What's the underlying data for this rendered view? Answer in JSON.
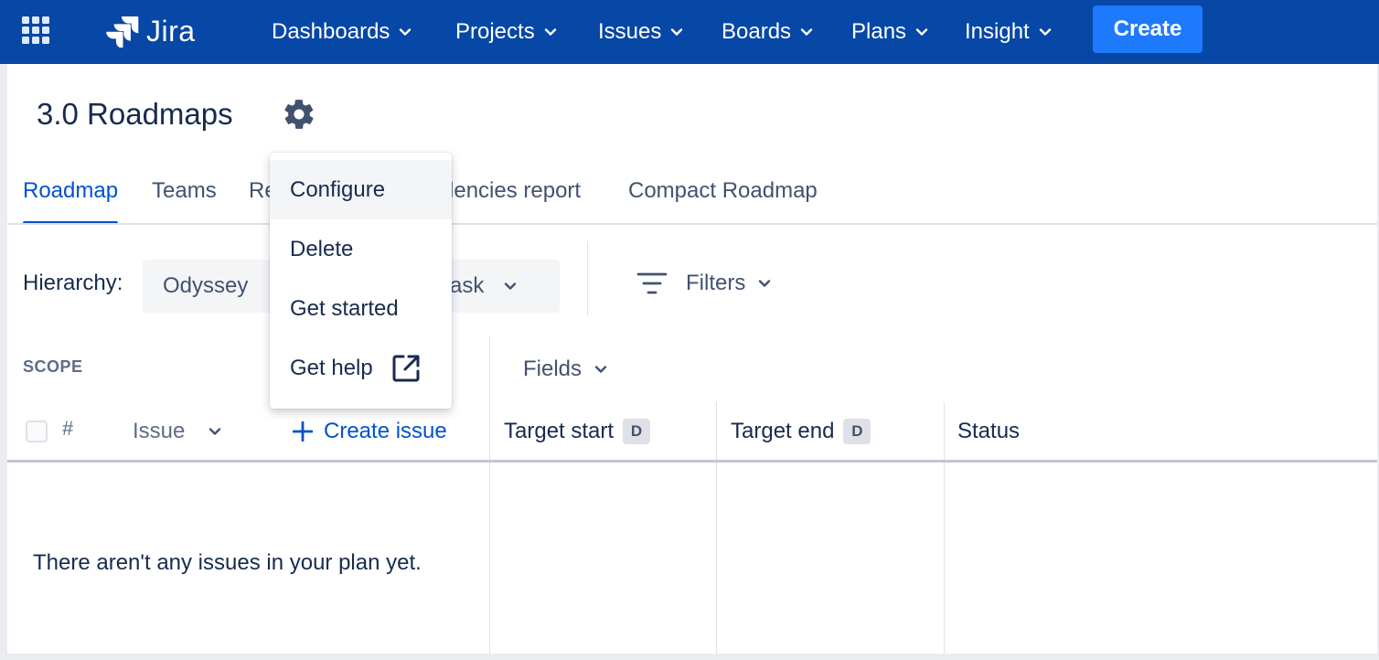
{
  "nav": {
    "logo": "Jira",
    "items": [
      {
        "label": "Dashboards"
      },
      {
        "label": "Projects"
      },
      {
        "label": "Issues"
      },
      {
        "label": "Boards"
      },
      {
        "label": "Plans"
      },
      {
        "label": "Insight"
      }
    ],
    "create_label": "Create"
  },
  "page": {
    "title": "3.0 Roadmaps",
    "tabs": [
      {
        "label": "Roadmap",
        "active": true
      },
      {
        "label": "Teams"
      },
      {
        "label": "Re"
      },
      {
        "label": "dencies report"
      },
      {
        "label": "Compact Roadmap"
      }
    ],
    "hierarchy": {
      "label": "Hierarchy:",
      "from": "Odyssey",
      "to": "ask"
    },
    "filters_label": "Filters",
    "scope_label": "SCOPE",
    "fields_label": "Fields",
    "columns": {
      "hash": "#",
      "issue": "Issue",
      "create_issue": "Create issue",
      "target_start": "Target start",
      "target_end": "Target end",
      "status": "Status",
      "date_badge": "D"
    },
    "empty_message": "There aren't any issues in your plan yet."
  },
  "menu": {
    "items": [
      {
        "label": "Configure"
      },
      {
        "label": "Delete"
      },
      {
        "label": "Get started"
      },
      {
        "label": "Get help"
      }
    ]
  },
  "colors": {
    "nav_bg": "#0747a6",
    "create_btn": "#1d7afc",
    "accent": "#0052cc"
  }
}
